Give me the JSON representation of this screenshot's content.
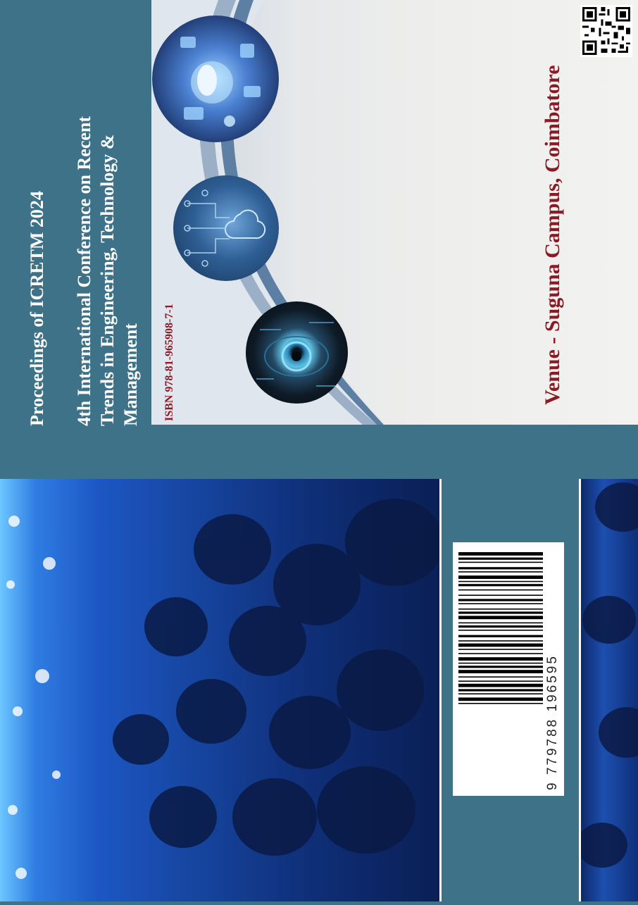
{
  "cover": {
    "proceedings_title": "Proceedings of ICRETM 2024",
    "conference_lines": [
      "4th International Conference on Recent",
      "Trends in Engineering, Technology &",
      "Management"
    ],
    "isbn": "ISBN 978-81-965908-7-1",
    "venue": "Venue - Suguna Campus, Coimbatore"
  },
  "barcode": {
    "digits": "9  779788  196595"
  },
  "colors": {
    "band": "#3e7288",
    "accent": "#8b1a24",
    "text_light": "#ffffff"
  },
  "icons": [
    "qr-code",
    "barcode"
  ]
}
